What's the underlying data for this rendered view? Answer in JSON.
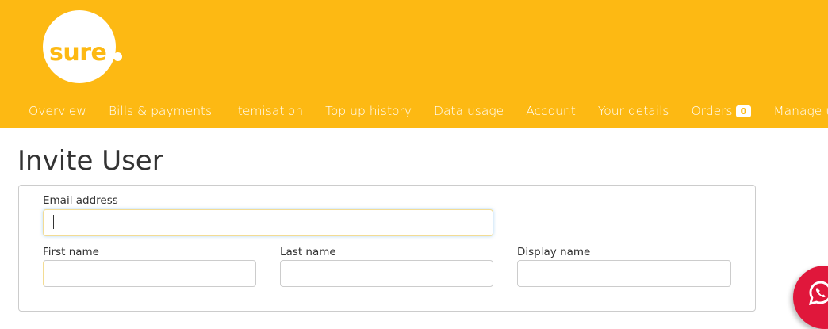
{
  "brand": {
    "logo_text": "sure",
    "color": "#fdb913"
  },
  "nav": {
    "items": [
      {
        "label": "Overview"
      },
      {
        "label": "Bills & payments"
      },
      {
        "label": "Itemisation"
      },
      {
        "label": "Top up history"
      },
      {
        "label": "Data usage"
      },
      {
        "label": "Account"
      },
      {
        "label": "Your details"
      },
      {
        "label": "Orders",
        "badge": "0"
      },
      {
        "label": "Manage users"
      }
    ]
  },
  "page": {
    "title": "Invite User"
  },
  "form": {
    "email_label": "Email address",
    "email_value": "",
    "first_name_label": "First name",
    "first_name_value": "",
    "last_name_label": "Last name",
    "last_name_value": "",
    "display_name_label": "Display name",
    "display_name_value": ""
  },
  "chat": {
    "icon": "whatsapp-icon",
    "color": "#e0173b"
  }
}
